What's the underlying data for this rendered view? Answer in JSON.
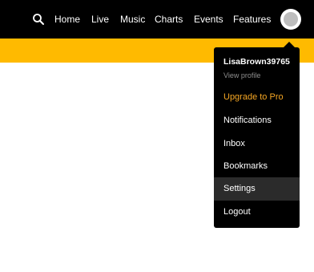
{
  "header": {
    "nav": [
      {
        "label": "Home"
      },
      {
        "label": "Live"
      },
      {
        "label": "Music"
      },
      {
        "label": "Charts"
      },
      {
        "label": "Events"
      },
      {
        "label": "Features"
      }
    ],
    "search_icon": "search-icon",
    "avatar_icon": "user-avatar-icon"
  },
  "user_menu": {
    "username": "LisaBrown39765",
    "view_profile": "View profile",
    "items": [
      {
        "label": "Upgrade to Pro",
        "color": "#f5a623"
      },
      {
        "label": "Notifications"
      },
      {
        "label": "Inbox"
      },
      {
        "label": "Bookmarks"
      },
      {
        "label": "Settings",
        "highlighted": true
      },
      {
        "label": "Logout"
      }
    ]
  },
  "colors": {
    "topbar": "#000000",
    "band": "#ffba00",
    "menu": "#000000",
    "accent": "#f5a623"
  }
}
